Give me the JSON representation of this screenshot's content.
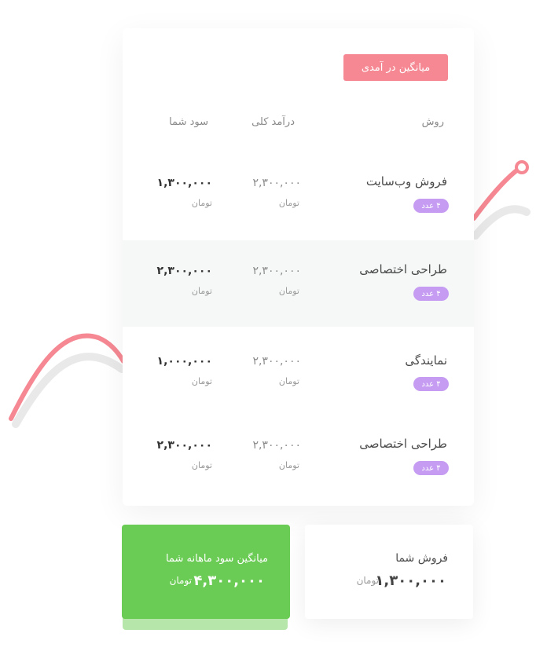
{
  "table": {
    "badge": "میانگین در آمدی",
    "headers": {
      "method": "روش",
      "total": "درآمد کلی",
      "profit": "سود شما"
    },
    "rows": [
      {
        "method": "فروش وب‌سایت",
        "count": "۴ عدد",
        "total": "۲,۳۰۰,۰۰۰",
        "total_unit": "تومان",
        "profit": "۱,۳۰۰,۰۰۰",
        "profit_unit": "تومان"
      },
      {
        "method": "طراحی اختصاصی",
        "count": "۴ عدد",
        "total": "۲,۳۰۰,۰۰۰",
        "total_unit": "تومان",
        "profit": "۲,۳۰۰,۰۰۰",
        "profit_unit": "تومان"
      },
      {
        "method": "نمایندگی",
        "count": "۴ عدد",
        "total": "۲,۳۰۰,۰۰۰",
        "total_unit": "تومان",
        "profit": "۱,۰۰۰,۰۰۰",
        "profit_unit": "تومان"
      },
      {
        "method": "طراحی اختصاصی",
        "count": "۴ عدد",
        "total": "۲,۳۰۰,۰۰۰",
        "total_unit": "تومان",
        "profit": "۲,۳۰۰,۰۰۰",
        "profit_unit": "تومان"
      }
    ]
  },
  "sales_card": {
    "title": "فروش شما",
    "value": "۱,۳۰۰,۰۰۰",
    "unit": "تومان"
  },
  "profit_card": {
    "title": "میانگین سود ماهانه شما",
    "value": "۴,۳۰۰,۰۰۰",
    "unit": "تومان"
  },
  "colors": {
    "accent_pink": "#f58893",
    "accent_green": "#6bcc55",
    "badge_purple": "#c59cf2"
  }
}
